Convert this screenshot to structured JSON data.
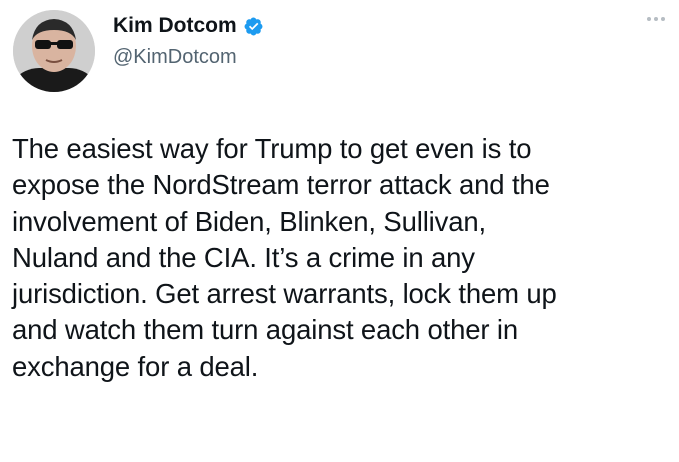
{
  "author": {
    "display_name": "Kim Dotcom",
    "handle": "@KimDotcom",
    "verified": true,
    "verified_color": "#1d9bf0",
    "avatar_icon": "profile-photo"
  },
  "menu": {
    "icon": "more-options-icon"
  },
  "tweet": {
    "text": "The easiest way for Trump to get even is to\nexpose the NordStream terror attack and the\ninvolvement of Biden, Blinken, Sullivan,\nNuland and the CIA. It’s a crime in any\njurisdiction. Get arrest warrants, lock them up\nand watch them turn against each other in\nexchange for a deal."
  }
}
